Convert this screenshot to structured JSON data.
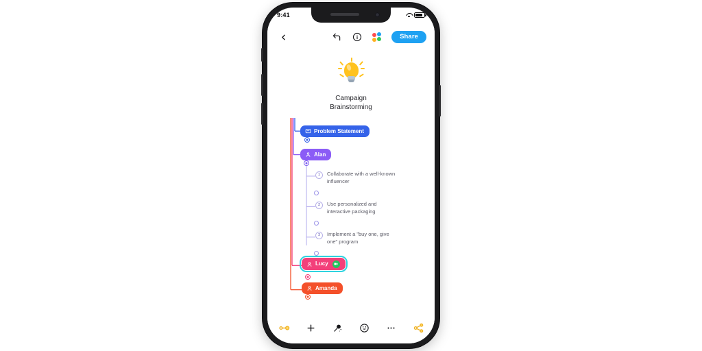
{
  "status_bar": {
    "time": "9:41",
    "wifi_icon": "wifi-icon",
    "battery_icon": "battery-icon",
    "battery_level": 82
  },
  "header": {
    "back_icon": "chevron-left-icon",
    "undo_icon": "undo-arrow-icon",
    "info_icon": "info-circle-icon",
    "apps_icon": "colorful-dots-icon",
    "share_label": "Share"
  },
  "root": {
    "icon": "lightbulb-icon",
    "title_line1": "Campaign",
    "title_line2": "Brainstorming"
  },
  "nodes": [
    {
      "id": "problem",
      "label": "Problem Statement",
      "color": "#3563E9",
      "glyph": "comment-square-icon",
      "selected": false
    },
    {
      "id": "alan",
      "label": "Alan",
      "color": "#8B5CF6",
      "glyph": "person-icon",
      "selected": false
    },
    {
      "id": "lucy",
      "label": "Lucy",
      "color": "#F3407A",
      "glyph": "person-icon",
      "selected": true,
      "badge": "video-camera-badge",
      "badge_color": "#22C55E",
      "selection_color": "#2ED3E0"
    },
    {
      "id": "amanda",
      "label": "Amanda",
      "color": "#F4502A",
      "glyph": "person-icon",
      "selected": false
    }
  ],
  "ideas": [
    {
      "number": "1",
      "text": "Collaborate with a well-known influencer"
    },
    {
      "number": "2",
      "text": "Use personalized and interactive packaging"
    },
    {
      "number": "3",
      "text": "Implement a \"buy one, give one\" program"
    }
  ],
  "toolbar": {
    "left_icon": "node-link-icon",
    "add_icon": "plus-icon",
    "magic_icon": "magic-wand-icon",
    "emoji_icon": "smiley-icon",
    "more_icon": "more-horizontal-icon",
    "right_icon": "share-nodes-icon",
    "accent_color": "#F0B429"
  },
  "theme": {
    "accent_blue": "#1EA1F2",
    "canvas_bg": "#FFFFFF",
    "frame_color": "#1B1B1D"
  }
}
